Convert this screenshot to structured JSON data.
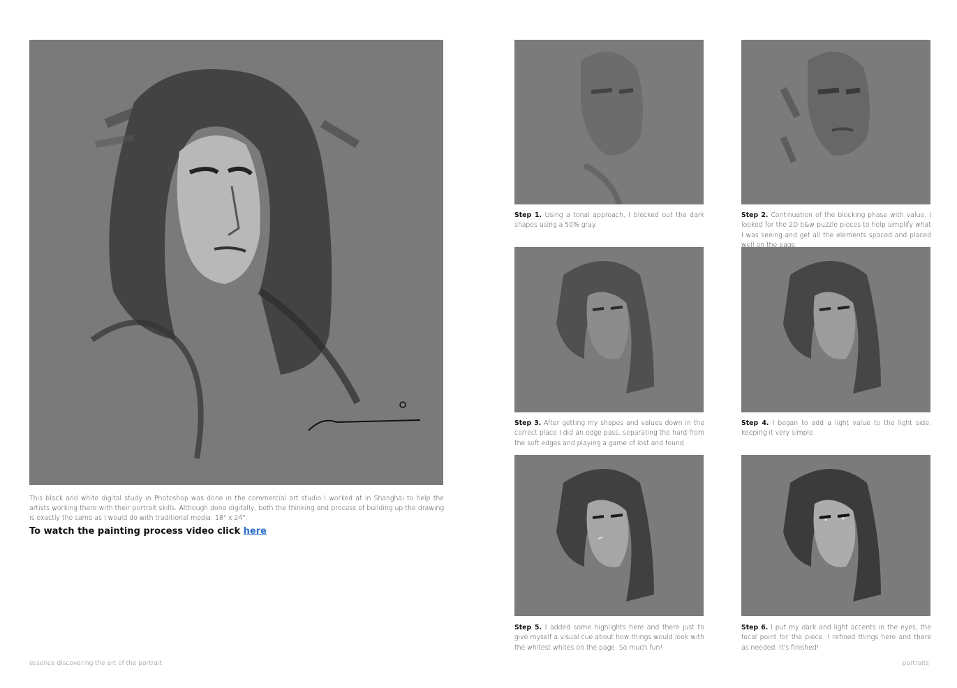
{
  "main": {
    "caption": "This black and white digital study in Photoshop was done in the commercial art studio I worked at in Shanghai to help the artists working there with their portrait skills. Although done digitally, both the thinking and process of building up the drawing is exactly the same as I would do with traditional media. 18\" x 24\".",
    "video_text": "To watch the painting process video click",
    "video_link": "here"
  },
  "steps": [
    {
      "label": "Step 1.",
      "text": "Using a tonal approach, I blocked out the dark shapes using a 50% gray."
    },
    {
      "label": "Step 2.",
      "text": "Continuation of the blocking phase with value. I looked for the 2D b&w puzzle pieces to help simplify what I was seeing and get all the elements spaced and placed well on the page."
    },
    {
      "label": "Step 3.",
      "text": "After getting my shapes and values down in the correct place I did an edge pass, separating the hard from the soft edges and playing a game of lost and found."
    },
    {
      "label": "Step 4.",
      "text": "I began to add a light value to the light side, keeping it very simple."
    },
    {
      "label": "Step 5.",
      "text": "I added some highlights here and there just to give myself a visual cue about how things would look with the whitest whites on the page. So much fun!"
    },
    {
      "label": "Step 6.",
      "text": "I put my dark and light accents in the eyes, the focal point for the piece. I refined things here and there as needed. It's finished!"
    }
  ],
  "footer": {
    "left": "essence discovering the art of the portrait",
    "right": "portraits"
  },
  "colors": {
    "canvas_gray": "#777777",
    "link": "#2a6fc9"
  }
}
